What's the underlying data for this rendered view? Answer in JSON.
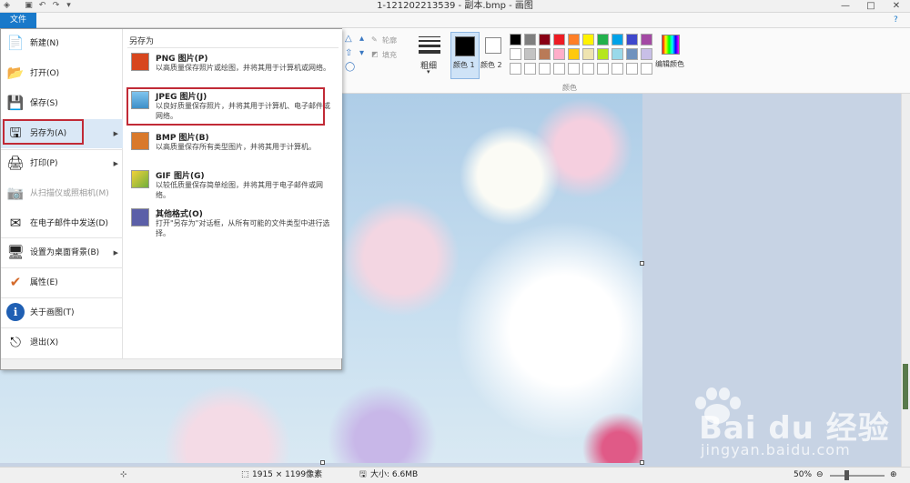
{
  "window": {
    "title": "1-121202213539 - 副本.bmp - 画图",
    "quick_access": [
      "▣",
      "↶",
      "↷",
      "▾"
    ],
    "controls": {
      "minimize": "—",
      "maximize": "□",
      "close": "✕"
    }
  },
  "ribbon": {
    "file_tab": "文件",
    "outline_label": "轮廓",
    "fill_label": "填充",
    "size_label": "粗细",
    "color1_label": "颜色 1",
    "color2_label": "颜色 2",
    "edit_colors_label": "编辑颜色",
    "palette_group_label": "颜色",
    "palette_row1": [
      "#000000",
      "#7f7f7f",
      "#880015",
      "#ed1c24",
      "#ff7f27",
      "#fff200",
      "#22b14c",
      "#00a2e8",
      "#3f48cc",
      "#a349a4"
    ],
    "palette_row2": [
      "#ffffff",
      "#c3c3c3",
      "#b97a57",
      "#ffaec9",
      "#ffc90e",
      "#efe4b0",
      "#b5e61d",
      "#99d9ea",
      "#7092be",
      "#c8bfe7"
    ]
  },
  "file_menu": {
    "items": [
      {
        "label": "新建(N)",
        "icon": "📄",
        "has_arrow": false,
        "disabled": false
      },
      {
        "label": "打开(O)",
        "icon": "📂",
        "has_arrow": false,
        "disabled": false
      },
      {
        "label": "保存(S)",
        "icon": "💾",
        "has_arrow": false,
        "disabled": false
      },
      {
        "label": "另存为(A)",
        "icon": "🖫",
        "has_arrow": true,
        "disabled": false
      },
      {
        "label": "打印(P)",
        "icon": "🖨",
        "has_arrow": true,
        "disabled": false
      },
      {
        "label": "从扫描仪或照相机(M)",
        "icon": "📷",
        "has_arrow": false,
        "disabled": true
      },
      {
        "label": "在电子邮件中发送(D)",
        "icon": "✉",
        "has_arrow": false,
        "disabled": false
      },
      {
        "label": "设置为桌面背景(B)",
        "icon": "🖥",
        "has_arrow": true,
        "disabled": false
      },
      {
        "label": "属性(E)",
        "icon": "✔",
        "has_arrow": false,
        "disabled": false
      },
      {
        "label": "关于画图(T)",
        "icon": "ℹ",
        "has_arrow": false,
        "disabled": false
      },
      {
        "label": "退出(X)",
        "icon": "⎋",
        "has_arrow": false,
        "disabled": false
      }
    ],
    "arrow_glyph": "▶",
    "saveas_panel": {
      "header": "另存为",
      "formats": [
        {
          "name": "PNG 图片(P)",
          "desc": "以高质量保存照片或绘图，并将其用于计算机或网络。",
          "color": "#d7461e"
        },
        {
          "name": "JPEG 图片(J)",
          "desc": "以良好质量保存照片，并将其用于计算机、电子邮件或网络。",
          "color": "#4aa3d8"
        },
        {
          "name": "BMP 图片(B)",
          "desc": "以高质量保存所有类型图片，并将其用于计算机。",
          "color": "#d9792b"
        },
        {
          "name": "GIF 图片(G)",
          "desc": "以较低质量保存简单绘图，并将其用于电子邮件或网络。",
          "color": "#6fae3c"
        },
        {
          "name": "其他格式(O)",
          "desc": "打开\"另存为\"对话框，从所有可能的文件类型中进行选择。",
          "color": "#5b5fa8"
        }
      ]
    }
  },
  "status_bar": {
    "dimensions": "1915 × 1199像素",
    "size": "大小: 6.6MB",
    "zoom": "50%",
    "zoom_out": "⊖",
    "zoom_in": "⊕"
  },
  "watermark": {
    "text": "Bai du 经验",
    "sub": "jingyan.baidu.com"
  }
}
